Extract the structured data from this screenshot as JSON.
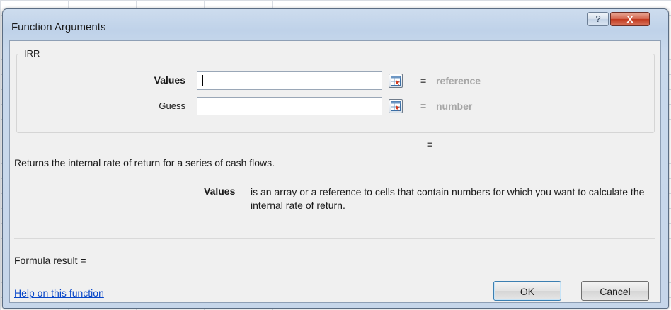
{
  "window": {
    "title": "Function Arguments",
    "help_glyph": "?",
    "close_glyph": "X"
  },
  "function": {
    "name": "IRR",
    "args": [
      {
        "label": "Values",
        "value": "",
        "hint": "reference",
        "equals": "="
      },
      {
        "label": "Guess",
        "value": "",
        "hint": "number",
        "equals": "="
      }
    ],
    "result_equals": "=",
    "description": "Returns the internal rate of return for a series of cash flows.",
    "arg_description_name": "Values",
    "arg_description_text": "is an array or a reference to cells that contain numbers for which you want to calculate the internal rate of return."
  },
  "footer": {
    "formula_result_label": "Formula result =",
    "help_link": "Help on this function",
    "ok_label": "OK",
    "cancel_label": "Cancel"
  },
  "icons": {
    "help": "help-icon",
    "close": "close-icon",
    "collapse": "range-selector-icon"
  }
}
